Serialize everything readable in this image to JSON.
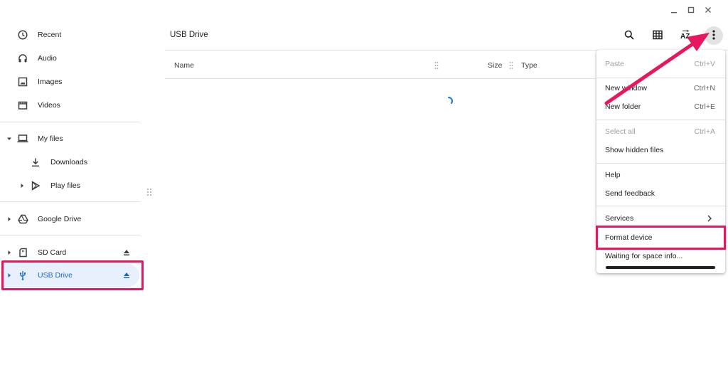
{
  "window": {
    "controls": [
      "minimize",
      "maximize",
      "close"
    ]
  },
  "sidebar": {
    "items": [
      {
        "label": "Recent",
        "icon": "clock-icon"
      },
      {
        "label": "Audio",
        "icon": "headphones-icon"
      },
      {
        "label": "Images",
        "icon": "image-icon"
      },
      {
        "label": "Videos",
        "icon": "film-icon"
      },
      {
        "label": "My files",
        "icon": "laptop-icon",
        "expanded": true
      },
      {
        "label": "Downloads",
        "icon": "download-icon"
      },
      {
        "label": "Play files",
        "icon": "play-store-icon"
      },
      {
        "label": "Google Drive",
        "icon": "google-drive-icon"
      },
      {
        "label": "SD Card",
        "icon": "sd-card-icon",
        "ejectable": true
      },
      {
        "label": "USB Drive",
        "icon": "usb-icon",
        "ejectable": true,
        "selected": true
      }
    ]
  },
  "header": {
    "title": "USB Drive",
    "toolbar": [
      "search-icon",
      "grid-view-icon",
      "sort-az-icon",
      "more-vert-icon"
    ]
  },
  "table": {
    "columns": [
      "Name",
      "Size",
      "Type"
    ]
  },
  "menu": {
    "items": [
      {
        "label": "Paste",
        "shortcut": "Ctrl+V",
        "disabled": true
      },
      {
        "label": "New window",
        "shortcut": "Ctrl+N"
      },
      {
        "label": "New folder",
        "shortcut": "Ctrl+E"
      },
      {
        "label": "Select all",
        "shortcut": "Ctrl+A",
        "disabled": true
      },
      {
        "label": "Show hidden files",
        "shortcut": ""
      },
      {
        "label": "Help",
        "shortcut": ""
      },
      {
        "label": "Send feedback",
        "shortcut": ""
      },
      {
        "label": "Services",
        "shortcut": "",
        "submenu": true
      },
      {
        "label": "Format device",
        "shortcut": ""
      },
      {
        "label": "Waiting for space info...",
        "shortcut": ""
      }
    ]
  },
  "colors": {
    "accent": "#1a73e8",
    "highlight": "#e8155f",
    "selected_bg": "#e8f0fe"
  }
}
